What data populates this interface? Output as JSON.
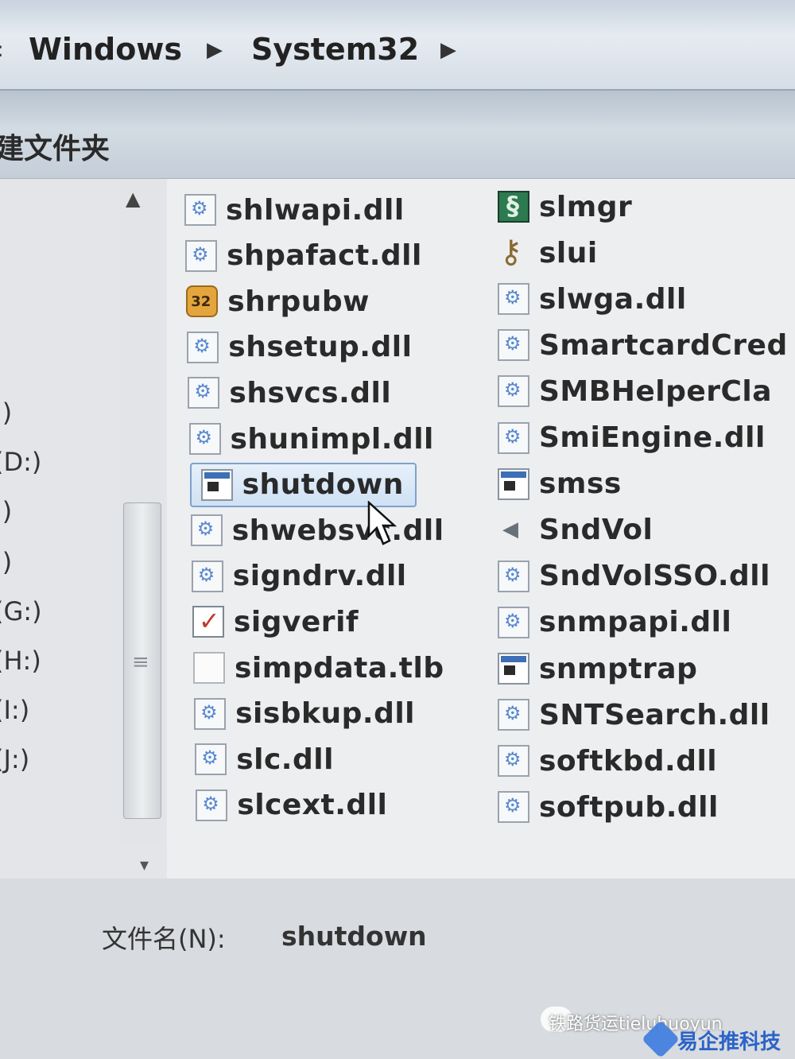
{
  "breadcrumb": {
    "items": [
      "Windows",
      "System32"
    ],
    "separator": "▶"
  },
  "toolbar": {
    "new_folder_label": "建文件夹"
  },
  "nav": {
    "drives": [
      ":)",
      "(D:)",
      ":)",
      ":)",
      "(G:)",
      "(H:)",
      "(I:)",
      "(J:)"
    ]
  },
  "files": {
    "column1": [
      {
        "name": "shlwapi.dll",
        "icon": "dll-icon"
      },
      {
        "name": "shpafact.dll",
        "icon": "dll-icon"
      },
      {
        "name": "shrpubw",
        "icon": "installer-icon"
      },
      {
        "name": "shsetup.dll",
        "icon": "dll-icon"
      },
      {
        "name": "shsvcs.dll",
        "icon": "dll-icon"
      },
      {
        "name": "shunimpl.dll",
        "icon": "dll-icon"
      },
      {
        "name": "shutdown",
        "icon": "exe-icon",
        "selected": true
      },
      {
        "name": "shwebsvc.dll",
        "icon": "dll-icon"
      },
      {
        "name": "signdrv.dll",
        "icon": "dll-icon"
      },
      {
        "name": "sigverif",
        "icon": "sign-icon"
      },
      {
        "name": "simpdata.tlb",
        "icon": "blank-file-icon"
      },
      {
        "name": "sisbkup.dll",
        "icon": "dll-icon"
      },
      {
        "name": "slc.dll",
        "icon": "dll-icon"
      },
      {
        "name": "slcext.dll",
        "icon": "dll-icon"
      }
    ],
    "column2": [
      {
        "name": "slmgr",
        "icon": "script-icon"
      },
      {
        "name": "slui",
        "icon": "key-icon"
      },
      {
        "name": "slwga.dll",
        "icon": "dll-icon"
      },
      {
        "name": "SmartcardCred",
        "icon": "dll-icon"
      },
      {
        "name": "SMBHelperCla",
        "icon": "dll-icon"
      },
      {
        "name": "SmiEngine.dll",
        "icon": "dll-icon"
      },
      {
        "name": "smss",
        "icon": "exe-icon"
      },
      {
        "name": "SndVol",
        "icon": "speaker-icon"
      },
      {
        "name": "SndVolSSO.dll",
        "icon": "dll-icon"
      },
      {
        "name": "snmpapi.dll",
        "icon": "dll-icon"
      },
      {
        "name": "snmptrap",
        "icon": "exe-icon"
      },
      {
        "name": "SNTSearch.dll",
        "icon": "dll-icon"
      },
      {
        "name": "softkbd.dll",
        "icon": "dll-icon"
      },
      {
        "name": "softpub.dll",
        "icon": "dll-icon"
      }
    ]
  },
  "filename_field": {
    "label": "文件名(N):",
    "value": "shutdown"
  },
  "watermark": {
    "text1": "铁路货运tieluhuoyun",
    "text2": "易企推科技"
  },
  "colors": {
    "selection_border": "#7da2ce",
    "selection_fill": "#cfe1f4"
  }
}
